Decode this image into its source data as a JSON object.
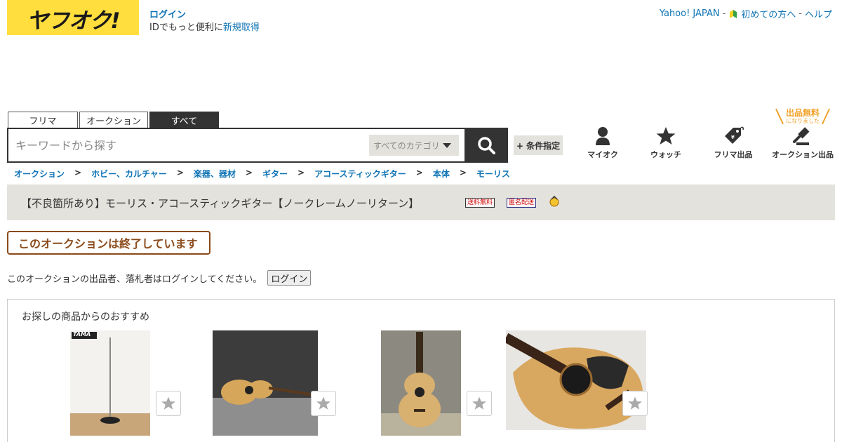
{
  "header": {
    "logo_text": "ヤフオク!",
    "login_label": "ログイン",
    "id_prefix": "IDでもっと便利に",
    "signup_label": "新規取得",
    "yahoo_japan": "Yahoo! JAPAN",
    "first_time": "初めての方へ",
    "help": "ヘルプ",
    "separator": "-"
  },
  "search": {
    "tabs": [
      {
        "label": "フリマ"
      },
      {
        "label": "オークション"
      },
      {
        "label": "すべて"
      }
    ],
    "placeholder": "キーワードから探す",
    "category_label": "すべてのカテゴリ",
    "condition_label": "+ 条件指定"
  },
  "nav": {
    "my_auction": "マイオク",
    "watch": "ウォッチ",
    "flea_listing": "フリマ出品",
    "auction_listing": "オークション出品",
    "free_listing_big": "出品無料",
    "free_listing_small": "になりました"
  },
  "breadcrumb": {
    "items": [
      "オークション",
      "ホビー、カルチャー",
      "楽器、器材",
      "ギター",
      "アコースティックギター",
      "本体",
      "モーリス"
    ],
    "separator": ">"
  },
  "item": {
    "title": "【不良箇所あり】モーリス・アコースティックギター【ノークレームノーリターン】",
    "badge_shipping": "送料無料",
    "badge_anonymous": "匿名配送"
  },
  "status": {
    "ended_message": "このオークションは終了しています",
    "login_note": "このオークションの出品者、落札者はログインしてください。",
    "login_button": "ログイン"
  },
  "recommend": {
    "title": "お探しの商品からのおすすめ",
    "items": [
      {
        "image": "mic-stand",
        "brand_text": "TAMA"
      },
      {
        "image": "guitar-floor"
      },
      {
        "image": "guitar-upright"
      },
      {
        "image": "guitar-closeup"
      }
    ]
  },
  "colors": {
    "brand_yellow": "#ffde3d",
    "link_blue": "#0f74b5",
    "ended_brown": "#8a4a1a",
    "title_bg": "#e4e2dd",
    "free_orange": "#f0a028"
  }
}
